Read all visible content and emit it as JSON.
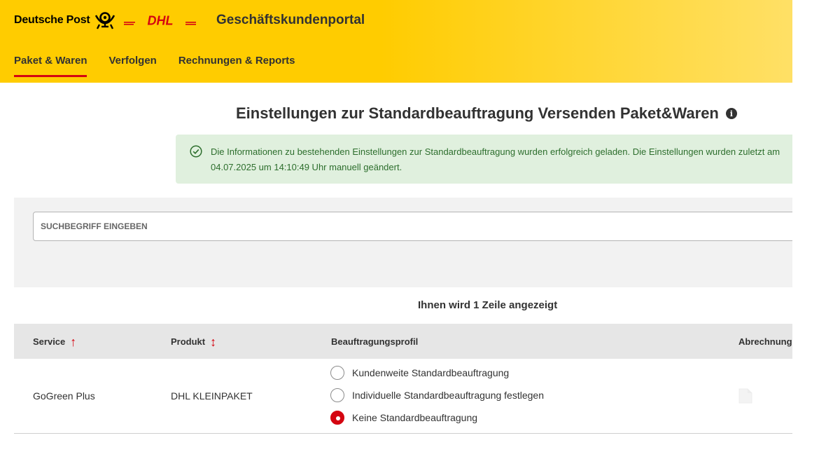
{
  "header": {
    "brand_name": "Deutsche Post",
    "dhl_logo": "DHL",
    "portal_title": "Geschäftskundenportal",
    "nav": [
      {
        "label": "Paket & Waren",
        "active": true
      },
      {
        "label": "Verfolgen",
        "active": false
      },
      {
        "label": "Rechnungen & Reports",
        "active": false
      }
    ]
  },
  "page": {
    "title": "Einstellungen zur Standardbeauftragung Versenden Paket&Waren",
    "info_icon": "info-icon"
  },
  "alert": {
    "icon": "check-circle-icon",
    "text": "Die Informationen zu bestehenden Einstellungen zur Standardbeauftragung wurden erfolgreich geladen. Die Einstellungen wurden zuletzt am 04.07.2025 um 14:10:49 Uhr manuell geändert."
  },
  "search": {
    "placeholder": "SUCHBEGRIFF EINGEBEN",
    "value": ""
  },
  "row_count_text": "Ihnen wird 1 Zeile angezeigt",
  "table": {
    "columns": [
      "Service",
      "Produkt",
      "Beauftragungsprofil",
      "Abrechnungs"
    ],
    "rows": [
      {
        "service": "GoGreen Plus",
        "produkt": "DHL KLEINPAKET",
        "options": [
          {
            "label": "Kundenweite Standardbeauftragung",
            "selected": false
          },
          {
            "label": "Individuelle Standardbeauftragung festlegen",
            "selected": false
          },
          {
            "label": "Keine Standardbeauftragung",
            "selected": true
          }
        ]
      }
    ]
  },
  "colors": {
    "brand_yellow": "#ffcc00",
    "accent_red": "#d40511",
    "success_bg": "#e0f0de",
    "success_text": "#2d6e2d"
  }
}
